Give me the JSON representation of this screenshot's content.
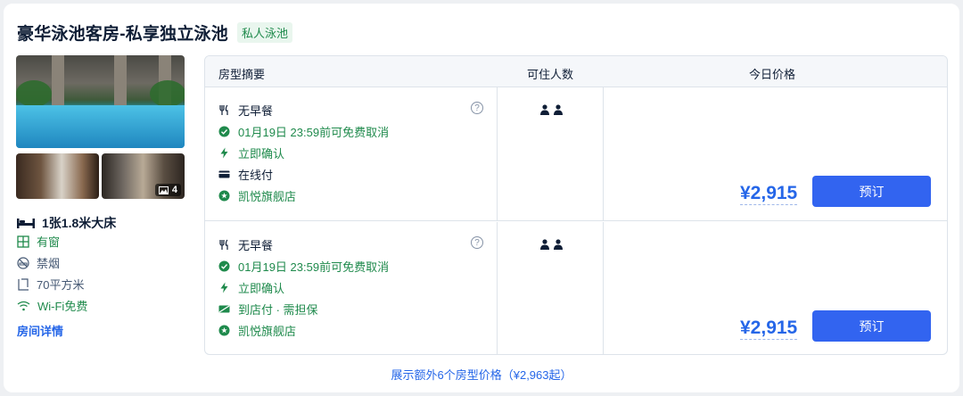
{
  "room": {
    "title": "豪华泳池客房-私享独立泳池",
    "tag": "私人泳池",
    "photo_count": "4",
    "bed": "1张1.8米大床",
    "features": {
      "window": "有窗",
      "smoking": "禁烟",
      "area": "70平方米",
      "wifi": "Wi-Fi免费"
    },
    "details_link": "房间详情"
  },
  "table": {
    "headers": {
      "summary": "房型摘要",
      "guests": "可住人数",
      "price": "今日价格"
    },
    "rows": [
      {
        "meal": "无早餐",
        "cancel": "01月19日 23:59前可免费取消",
        "confirm": "立即确认",
        "payment": "在线付",
        "store": "凯悦旗舰店",
        "help": "?",
        "price": "¥2,915",
        "book": "预订"
      },
      {
        "meal": "无早餐",
        "cancel": "01月19日 23:59前可免费取消",
        "confirm": "立即确认",
        "payment": "到店付 · 需担保",
        "store": "凯悦旗舰店",
        "help": "?",
        "price": "¥2,915",
        "book": "预订"
      }
    ]
  },
  "more_link": "展示额外6个房型价格（¥2,963起）",
  "colors": {
    "brand_blue": "#3264f0",
    "link_blue": "#2566e8",
    "green": "#1f8a4c",
    "text": "#0f1e36"
  }
}
